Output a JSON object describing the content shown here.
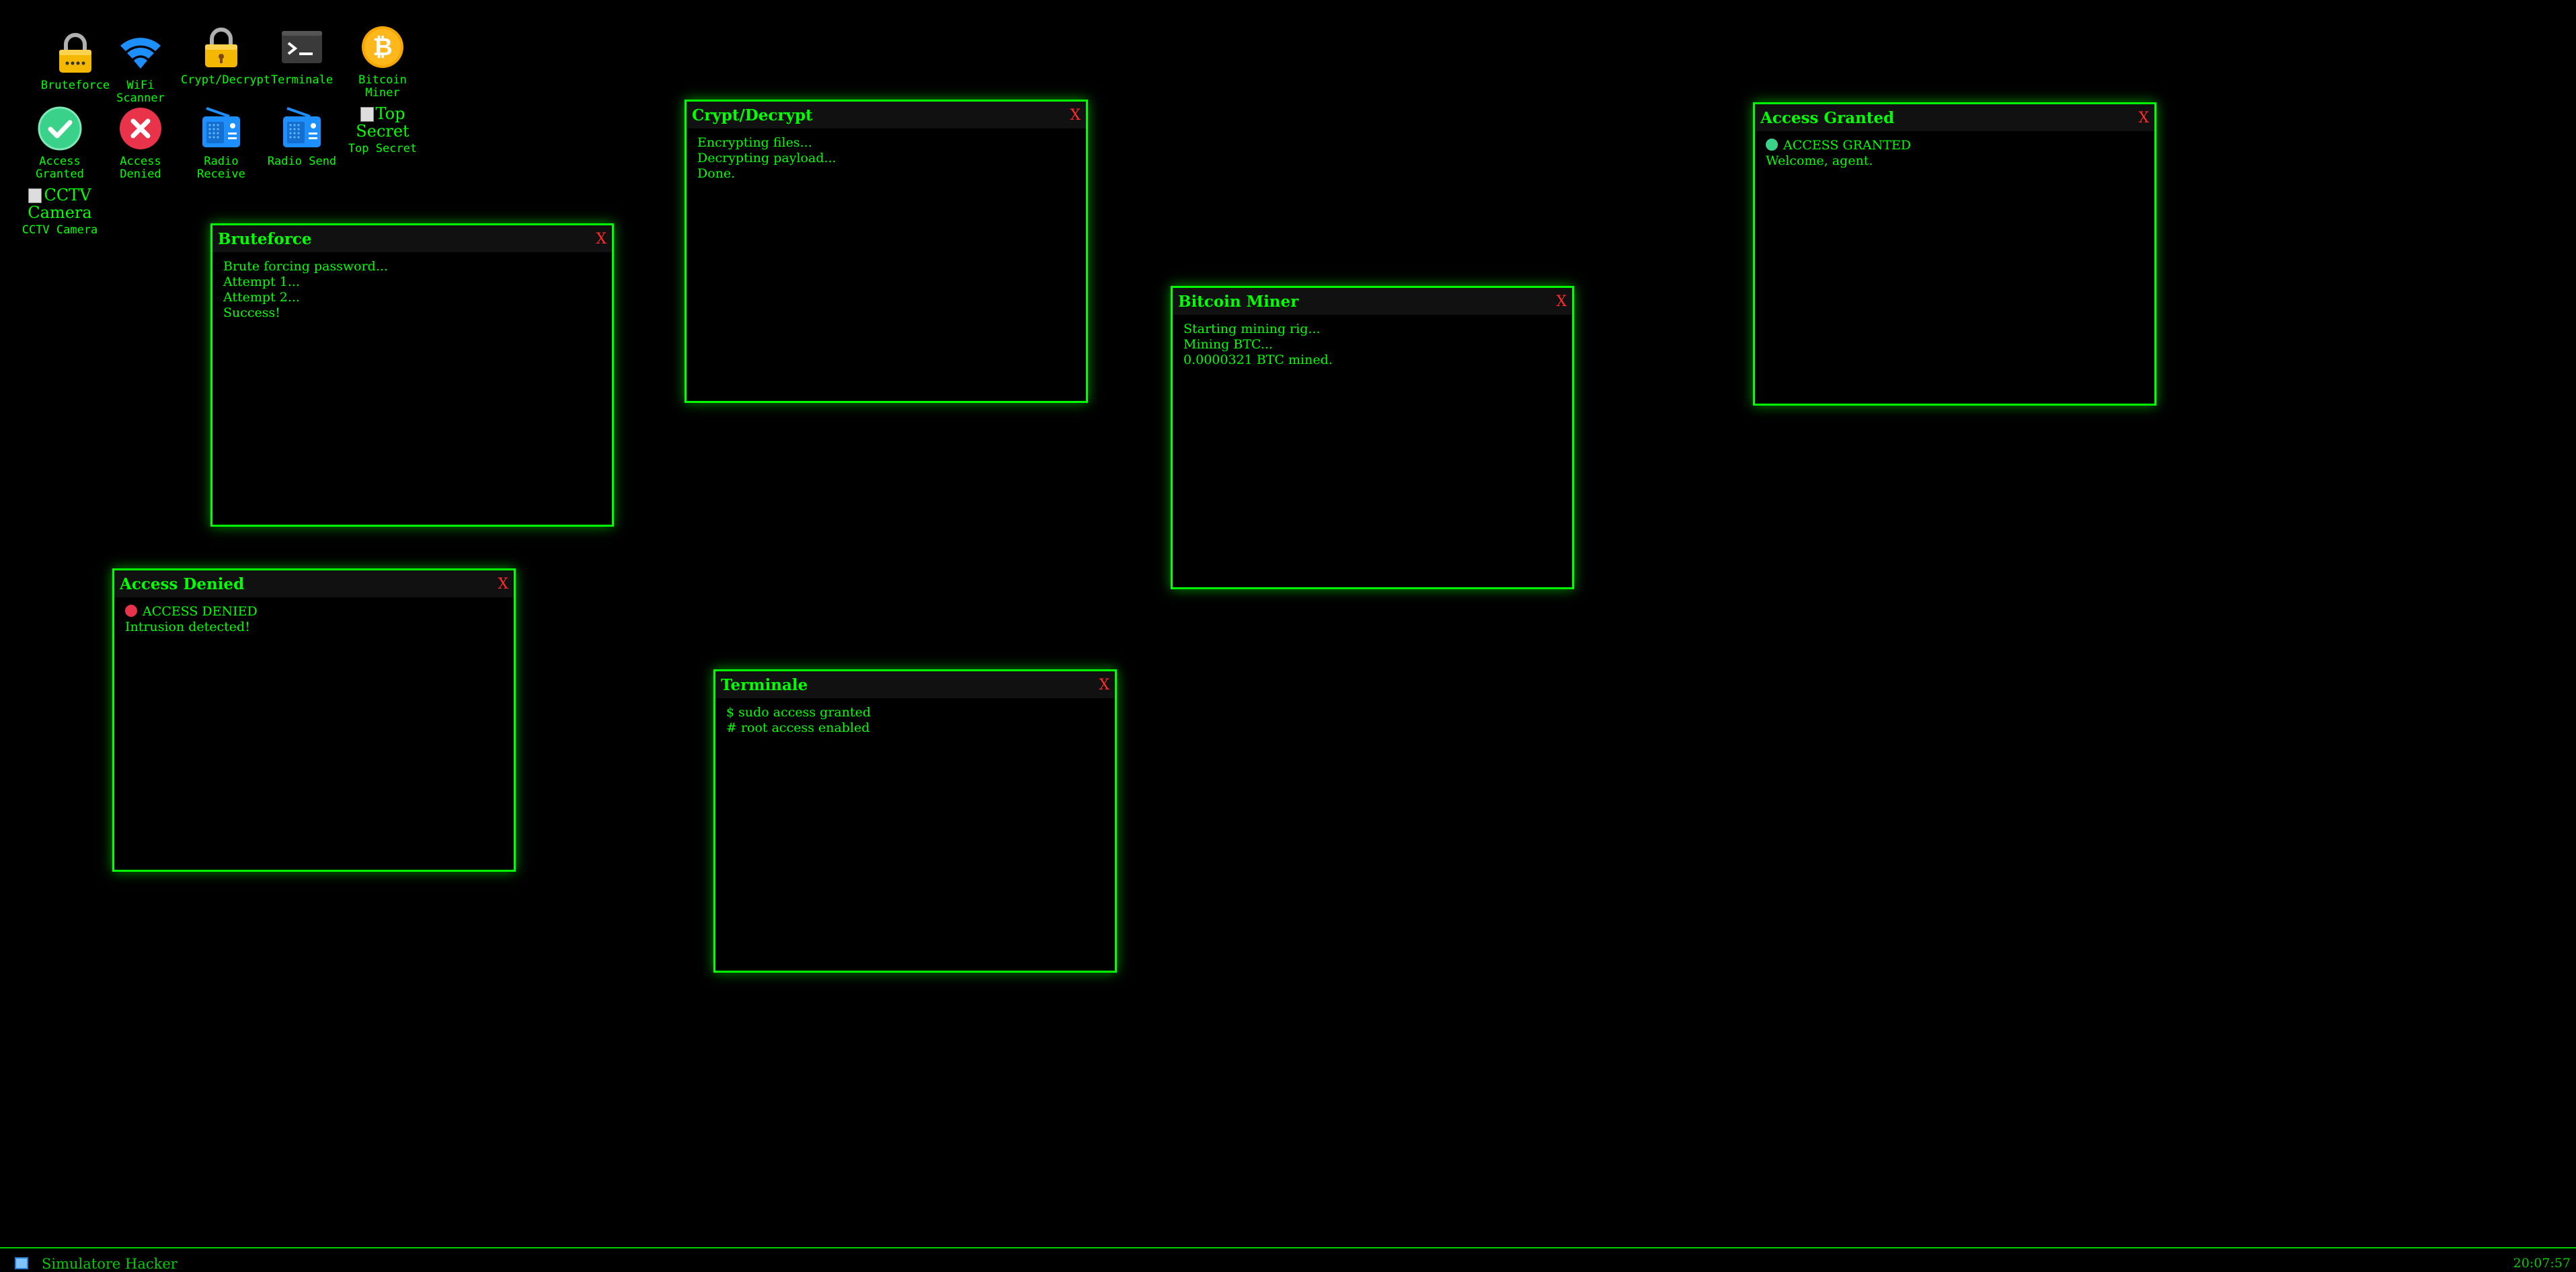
{
  "desktop": {
    "icons": [
      {
        "label": "Bruteforce",
        "icon": "padlock-icon"
      },
      {
        "label": "WiFi Scanner",
        "icon": "wifi-icon"
      },
      {
        "label": "Crypt/Decrypt",
        "icon": "padlock-icon"
      },
      {
        "label": "Terminale",
        "icon": "terminal-icon"
      },
      {
        "label": "Bitcoin Miner",
        "icon": "bitcoin-icon"
      },
      {
        "label": "Access Granted",
        "icon": "check-circle-icon"
      },
      {
        "label": "Access Denied",
        "icon": "x-circle-icon"
      },
      {
        "label": "Radio Receive",
        "icon": "radio-icon"
      },
      {
        "label": "Radio Send",
        "icon": "radio-icon"
      },
      {
        "label": "Top Secret",
        "alt": "Top Secret",
        "icon": "broken-image-icon"
      },
      {
        "label": "CCTV Camera",
        "alt": "CCTV Camera",
        "icon": "broken-image-icon"
      }
    ]
  },
  "windows": {
    "bruteforce": {
      "title": "Bruteforce",
      "close": "X",
      "lines": [
        "Brute forcing password...",
        "Attempt 1...",
        "Attempt 2...",
        "Success!"
      ]
    },
    "crypt": {
      "title": "Crypt/Decrypt",
      "close": "X",
      "lines": [
        "Encrypting files...",
        "Decrypting payload...",
        "Done."
      ]
    },
    "bitcoin": {
      "title": "Bitcoin Miner",
      "close": "X",
      "lines": [
        "Starting mining rig...",
        "Mining BTC...",
        "0.0000321 BTC mined."
      ]
    },
    "granted": {
      "title": "Access Granted",
      "close": "X",
      "status": "ACCESS GRANTED",
      "lines": [
        "Welcome, agent."
      ],
      "dot_color": "#3ad28a"
    },
    "denied": {
      "title": "Access Denied",
      "close": "X",
      "status": "ACCESS DENIED",
      "lines": [
        "Intrusion detected!"
      ],
      "dot_color": "#e8334a"
    },
    "terminale": {
      "title": "Terminale",
      "close": "X",
      "lines": [
        "$ sudo access granted",
        "# root access enabled"
      ]
    }
  },
  "taskbar": {
    "title": "Simulatore Hacker",
    "clock": "20:07:57"
  },
  "colors": {
    "accent": "#00ff00",
    "close": "#ff2a2a",
    "background": "#000000"
  }
}
